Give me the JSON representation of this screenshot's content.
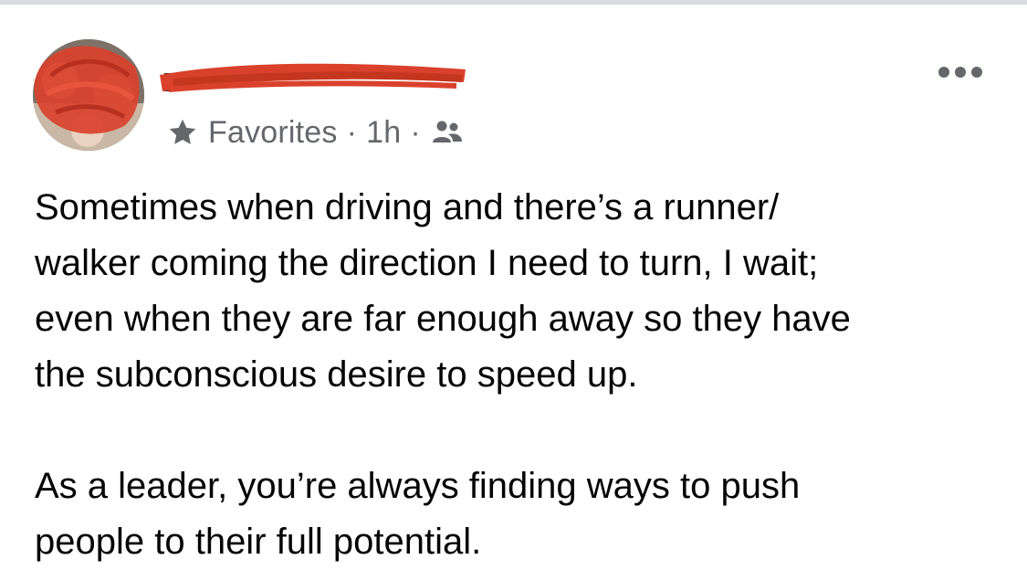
{
  "post": {
    "author": {
      "name_redacted": true
    },
    "meta": {
      "audience_list": "Favorites",
      "separator": "·",
      "time": "1h",
      "icons": [
        "star-icon",
        "friends-icon"
      ]
    },
    "more_label": "More options",
    "paragraphs": [
      "Sometimes when driving and there’s a runner/\nwalker coming the direction I need to turn, I wait;\neven when they are far enough away so they have\nthe subconscious desire to speed up.",
      "As a leader, you’re always finding ways to push\npeople to their full potential."
    ]
  },
  "colors": {
    "redaction": "#d9412c",
    "meta_text": "#65676b",
    "body_text": "#050505",
    "top_rule": "#d9dbe0"
  }
}
